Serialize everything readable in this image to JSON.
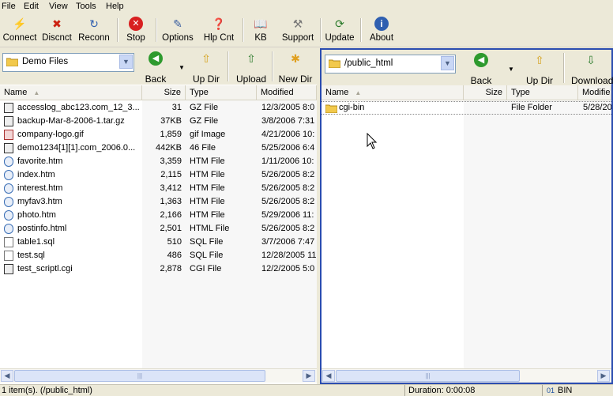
{
  "menu": [
    "File",
    "Edit",
    "View",
    "Tools",
    "Help"
  ],
  "toolbar": [
    {
      "label": "Connect",
      "icon": "connect-icon"
    },
    {
      "label": "Discnct",
      "icon": "disconnect-icon"
    },
    {
      "label": "Reconn",
      "icon": "reconnect-icon"
    },
    {
      "label": "Stop",
      "icon": "stop-icon"
    },
    {
      "label": "Options",
      "icon": "options-icon"
    },
    {
      "label": "Hlp Cnt",
      "icon": "help-center-icon"
    },
    {
      "label": "KB",
      "icon": "knowledge-base-icon"
    },
    {
      "label": "Support",
      "icon": "support-icon"
    },
    {
      "label": "Update",
      "icon": "update-icon"
    },
    {
      "label": "About",
      "icon": "about-icon"
    }
  ],
  "local": {
    "folder": "Demo Files",
    "buttons": [
      "Back",
      "Up Dir",
      "Upload",
      "New Dir"
    ],
    "columns": [
      "Name",
      "Size",
      "Type",
      "Modified"
    ],
    "files": [
      {
        "name": "accesslog_abc123.com_12_3...",
        "size": "31",
        "type": "GZ File",
        "modified": "12/3/2005 8:0",
        "kind": "gz"
      },
      {
        "name": "backup-Mar-8-2006-1.tar.gz",
        "size": "37KB",
        "type": "GZ File",
        "modified": "3/8/2006 7:31",
        "kind": "gz"
      },
      {
        "name": "company-logo.gif",
        "size": "1,859",
        "type": "gif Image",
        "modified": "4/21/2006 10:",
        "kind": "gif"
      },
      {
        "name": "demo1234[1][1].com_2006.0...",
        "size": "442KB",
        "type": "46 File",
        "modified": "5/25/2006 6:4",
        "kind": "gz"
      },
      {
        "name": "favorite.htm",
        "size": "3,359",
        "type": "HTM File",
        "modified": "1/11/2006 10:",
        "kind": "htm"
      },
      {
        "name": "index.htm",
        "size": "2,115",
        "type": "HTM File",
        "modified": "5/26/2005 8:2",
        "kind": "htm"
      },
      {
        "name": "interest.htm",
        "size": "3,412",
        "type": "HTM File",
        "modified": "5/26/2005 8:2",
        "kind": "htm"
      },
      {
        "name": "myfav3.htm",
        "size": "1,363",
        "type": "HTM File",
        "modified": "5/26/2005 8:2",
        "kind": "htm"
      },
      {
        "name": "photo.htm",
        "size": "2,166",
        "type": "HTM File",
        "modified": "5/29/2006 11:",
        "kind": "htm"
      },
      {
        "name": "postinfo.html",
        "size": "2,501",
        "type": "HTML File",
        "modified": "5/26/2005 8:2",
        "kind": "htm"
      },
      {
        "name": "table1.sql",
        "size": "510",
        "type": "SQL File",
        "modified": "3/7/2006 7:47",
        "kind": "sql"
      },
      {
        "name": "test.sql",
        "size": "486",
        "type": "SQL File",
        "modified": "12/28/2005 11",
        "kind": "sql"
      },
      {
        "name": "test_scriptl.cgi",
        "size": "2,878",
        "type": "CGI File",
        "modified": "12/2/2005 5:0",
        "kind": "gz"
      }
    ]
  },
  "remote": {
    "folder": "/public_html",
    "buttons": [
      "Back",
      "Up Dir",
      "Download"
    ],
    "columns": [
      "Name",
      "Size",
      "Type",
      "Modifie"
    ],
    "files": [
      {
        "name": "cgi-bin",
        "size": "",
        "type": "File Folder",
        "modified": "5/28/20"
      }
    ]
  },
  "status": {
    "items": "1 item(s).  (/public_html)",
    "duration": "Duration: 0:00:08",
    "mode": "BIN"
  }
}
